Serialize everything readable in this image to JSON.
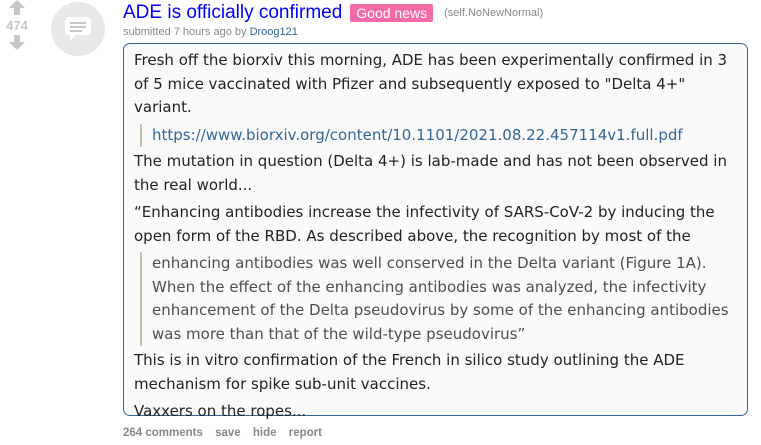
{
  "post": {
    "score": "474",
    "title": "ADE is officially confirmed",
    "flair": "Good news",
    "domain": "(self.NoNewNormal)",
    "tagline": {
      "prefix": "submitted 7 hours ago by ",
      "author": "Droog121"
    },
    "body": {
      "p1": "Fresh off the biorxiv this morning, ADE has been experimentally confirmed in 3 of 5 mice vaccinated with Pfizer and subsequently exposed to \"Delta 4+\" variant.",
      "link": "https://www.biorxiv.org/content/10.1101/2021.08.22.457114v1.full.pdf",
      "p2": "The mutation in question (Delta 4+) is lab-made and has not been observed in the real world...",
      "p3": "“Enhancing antibodies increase the infectivity of SARS-CoV-2 by inducing the open form of the RBD. As described above, the recognition by most of the",
      "quote": "enhancing antibodies was well conserved in the Delta variant (Figure 1A). When the effect of the enhancing antibodies was analyzed, the infectivity enhancement of the Delta pseudovirus by some of the enhancing antibodies was more than that of the wild-type pseudovirus”",
      "p4": "This is in vitro confirmation of the French in silico study outlining the ADE mechanism for spike sub-unit vaccines.",
      "p5": "Vaxxers on the ropes..."
    },
    "buttons": {
      "comments": "264 comments",
      "save": "save",
      "hide": "hide",
      "report": "report"
    }
  },
  "colors": {
    "title": "#0000ff",
    "flair_bg": "#f36aa6",
    "selftext_border": "#336699",
    "selftext_bg": "#fafafa",
    "muted": "#888888"
  },
  "icons": {
    "upvote": "upvote-arrow-icon",
    "downvote": "downvote-arrow-icon",
    "thumbnail": "self-post-icon"
  }
}
